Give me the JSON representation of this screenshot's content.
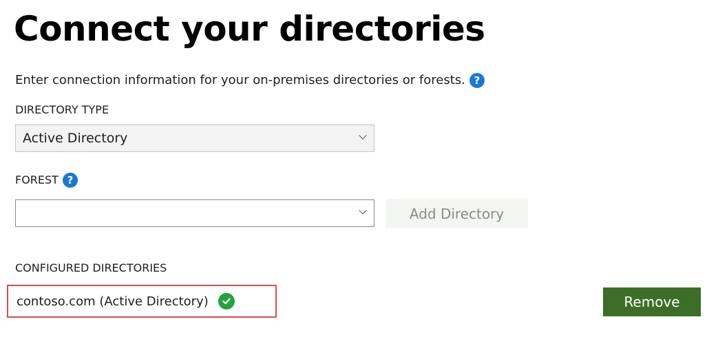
{
  "page": {
    "title": "Connect your directories",
    "intro": "Enter connection information for your on-premises directories or forests."
  },
  "directory_type": {
    "label": "DIRECTORY TYPE",
    "selected": "Active Directory"
  },
  "forest": {
    "label": "FOREST",
    "selected": ""
  },
  "buttons": {
    "add_directory": "Add Directory",
    "remove": "Remove"
  },
  "configured": {
    "label": "CONFIGURED DIRECTORIES",
    "items": [
      {
        "name": "contoso.com (Active Directory)",
        "status_icon": "check-circle-icon"
      }
    ]
  },
  "icons": {
    "help": "?"
  },
  "colors": {
    "help_blue": "#1b78d6",
    "success_green": "#20a53b",
    "remove_button": "#3d6e28",
    "highlight_border": "#e04a4a"
  }
}
